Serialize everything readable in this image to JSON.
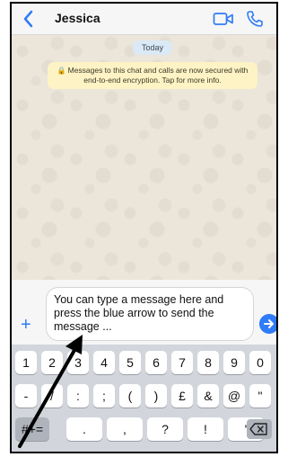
{
  "header": {
    "contact_name": "Jessica",
    "icons": [
      "back-chevron-icon",
      "video-call-icon",
      "phone-call-icon"
    ]
  },
  "chat": {
    "date_badge": "Today",
    "notice": "Messages to this chat and calls are now secured with end-to-end encryption. Tap for more info."
  },
  "composer": {
    "message_text": "You can type a message here and press the blue arrow to send the message ...",
    "icons": [
      "plus-icon",
      "send-arrow-icon"
    ]
  },
  "keyboard": {
    "row1": [
      "1",
      "2",
      "3",
      "4",
      "5",
      "6",
      "7",
      "8",
      "9",
      "0"
    ],
    "row2": [
      "-",
      "/",
      ":",
      ";",
      "(",
      ")",
      "£",
      "&",
      "@",
      "\""
    ],
    "row3": [
      ".",
      ",",
      "?",
      "!",
      "'"
    ],
    "icons": [
      "backspace-icon"
    ]
  },
  "colors": {
    "accent_blue": "#2f7cf6",
    "notice_bg": "#fdf3c4",
    "keyboard_bg": "#d2d5db"
  }
}
